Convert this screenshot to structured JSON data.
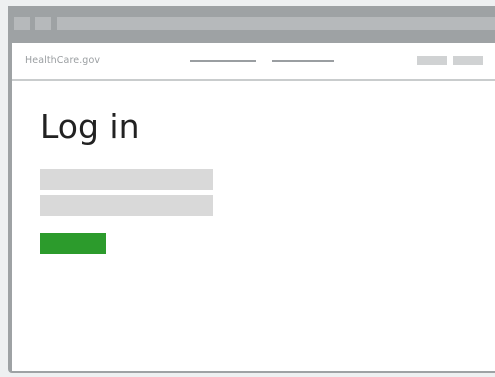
{
  "header": {
    "logo_text": "HealthCare.gov",
    "nav_links": [
      "",
      ""
    ],
    "buttons": [
      "",
      ""
    ]
  },
  "main": {
    "title": "Log in",
    "username": {
      "value": "",
      "placeholder": ""
    },
    "password": {
      "value": "",
      "placeholder": ""
    },
    "submit_label": ""
  },
  "colors": {
    "primary_button": "#2c9b2c",
    "page_background": "#ffffff",
    "chrome": "#9ea2a4",
    "field_background": "#d9d9d9"
  }
}
